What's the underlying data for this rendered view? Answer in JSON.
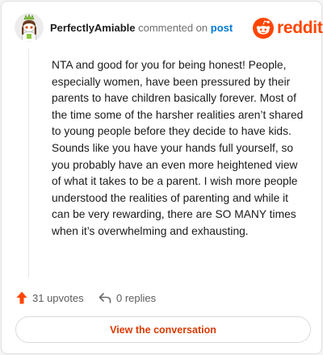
{
  "header": {
    "username": "PerfectlyAmiable",
    "action_text": "commented on",
    "post_link": "post",
    "brand": "reddit"
  },
  "comment": {
    "body": "NTA and good for you for being honest! People, especially women, have been pressured by their parents to have children basically forever. Most of the time some of the harsher realities aren’t shared to young people before they decide to have kids. Sounds like you have your hands full yourself, so you probably have an even more heightened view of what it takes to be a parent. I wish more people understood the realities of parenting and while it can be very rewarding, there are SO MANY times when it’s overwhelming and exhausting."
  },
  "footer": {
    "upvotes": "31 upvotes",
    "replies": "0 replies",
    "cta": "View the conversation"
  },
  "colors": {
    "brand": "#ff4500",
    "upvote": "#ff4500",
    "link": "#0079d3",
    "cta_text": "#d93a00"
  },
  "icons": {
    "avatar": "avatar-icon",
    "brand": "reddit-snoo-icon",
    "upvote": "upvote-arrow-icon",
    "reply": "reply-arrow-icon"
  }
}
